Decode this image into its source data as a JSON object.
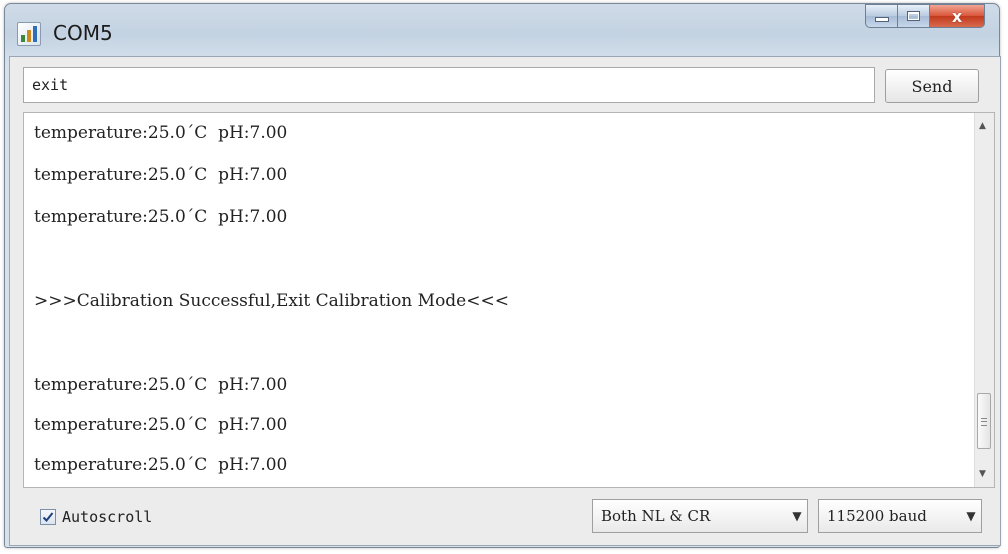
{
  "window": {
    "title": "COM5",
    "close_glyph": "x"
  },
  "input": {
    "value": "exit"
  },
  "send_button": {
    "label": "Send"
  },
  "output_lines": [
    "temperature:25.0ˊC  pH:7.00",
    "temperature:25.0ˊC  pH:7.00",
    "temperature:25.0ˊC  pH:7.00",
    "",
    ">>>Calibration Successful,Exit Calibration Mode<<<",
    "",
    "temperature:25.0ˊC  pH:7.00",
    "temperature:25.0ˊC  pH:7.00",
    "temperature:25.0ˊC  pH:7.00"
  ],
  "autoscroll": {
    "label": "Autoscroll",
    "checked": true
  },
  "line_ending": {
    "value": "Both NL & CR"
  },
  "baud_rate": {
    "value": "115200 baud"
  },
  "icons": {
    "app": "serial-monitor-icon",
    "minimize": "minimize-icon",
    "maximize": "maximize-icon",
    "close": "close-icon",
    "dropdown": "chevron-down-icon"
  }
}
